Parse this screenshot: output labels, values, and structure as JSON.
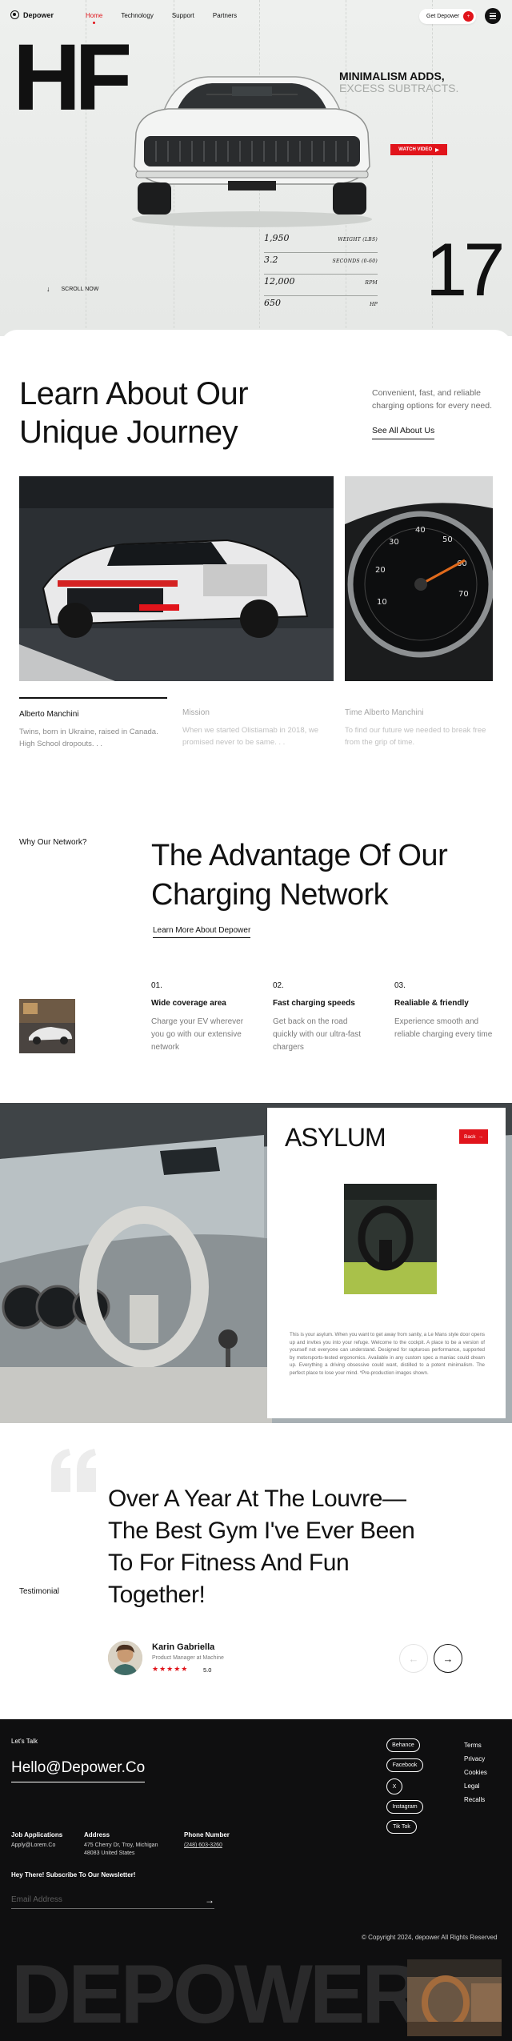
{
  "colors": {
    "accent": "#e1141b",
    "hero_bg": "#eef0ee",
    "footer_bg": "#0f0f10"
  },
  "nav": {
    "logo": "Depower",
    "links": [
      {
        "label": "Home",
        "active": true
      },
      {
        "label": "Technology",
        "active": false
      },
      {
        "label": "Support",
        "active": false
      },
      {
        "label": "Partners",
        "active": false
      }
    ],
    "cta_label": "Get Depower",
    "cta_badge": "+",
    "menu_icon": "hamburger-icon"
  },
  "hero": {
    "monogram": "HF",
    "tagline_bold": "MINIMALISM ADDS,",
    "tagline_light": "EXCESS SUBTRACTS.",
    "watch_label": "WATCH VIDEO",
    "scroll_label": "SCROLL NOW",
    "specs": [
      {
        "value": "1,950",
        "unit": "WEIGHT (LBS)"
      },
      {
        "value": "3.2",
        "unit": "SECONDS (0-60)"
      },
      {
        "value": "12,000",
        "unit": "RPM"
      },
      {
        "value": "650",
        "unit": "HP"
      }
    ],
    "big_number": "17"
  },
  "journey": {
    "title": "Learn About Our Unique Journey",
    "subtitle": "Convenient, fast, and reliable charging options for every need.",
    "link": "See All About Us",
    "cards": [
      {
        "title": "Alberto Manchini",
        "text": "Twins, born in Ukraine, raised in Canada. High School dropouts. . ."
      },
      {
        "title": "Mission",
        "text": "When we started Olistiamab in 2018, we promised never to be same. . ."
      },
      {
        "title": "Time Alberto Manchini",
        "text": "To find our future we needed to break free from the grip of time."
      }
    ]
  },
  "advantage": {
    "eyebrow": "Why Our Network?",
    "title": "The Advantage Of Our Charging Network",
    "link": "Learn More About Depower",
    "features": [
      {
        "num": "01.",
        "title": "Wide coverage area",
        "text": "Charge your EV wherever you go with our extensive network"
      },
      {
        "num": "02.",
        "title": "Fast charging speeds",
        "text": "Get back on the road quickly with our ultra-fast chargers"
      },
      {
        "num": "03.",
        "title": "Realiable & friendly",
        "text": "Experience smooth and reliable charging every time"
      }
    ]
  },
  "asylum": {
    "title": "ASYLUM",
    "back_label": "Back",
    "text": "This is your asylum. When you want to get away from sanity, a Le Mans style door opens up and invites you into your refuge. Welcome to the cockpit. A place to be a version of yourself not everyone can understand. Designed for rapturous performance, supported by motorsports-tested ergonomics. Available in any custom spec a maniac could dream up. Everything a driving obsessive could want, distilled to a potent minimalism. The perfect place to lose your mind. *Pre-production images shown."
  },
  "testimonial": {
    "label": "Testimonial",
    "quote": "Over A Year At The Louvre—The Best Gym I've Ever Been To For Fitness And Fun Together!",
    "author": "Karin Gabriella",
    "role": "Product Manager at Machine",
    "stars": "★★★★★",
    "rating": "5.0"
  },
  "footer": {
    "lets_talk": "Let's Talk",
    "email": "Hello@Depower.Co",
    "socials": [
      "Behance",
      "Facebook",
      "X",
      "Instagram",
      "Tik Tok"
    ],
    "links": [
      "Terms",
      "Privacy",
      "Cookies",
      "Legal",
      "Recalls"
    ],
    "job_title": "Job Applications",
    "job_email": "Apply@Lorem.Co",
    "address_title": "Address",
    "address_line1": "475 Cherry Dr, Troy, Michigan",
    "address_line2": "48083 United States",
    "phone_title": "Phone Number",
    "phone": "(248) 603-3260",
    "newsletter": "Hey There! Subscribe To Our Newsletter!",
    "email_placeholder": "Email Address",
    "copyright": "© Copyright 2024, depower All Rights Reserved",
    "wordmark": "DEPOWER"
  }
}
